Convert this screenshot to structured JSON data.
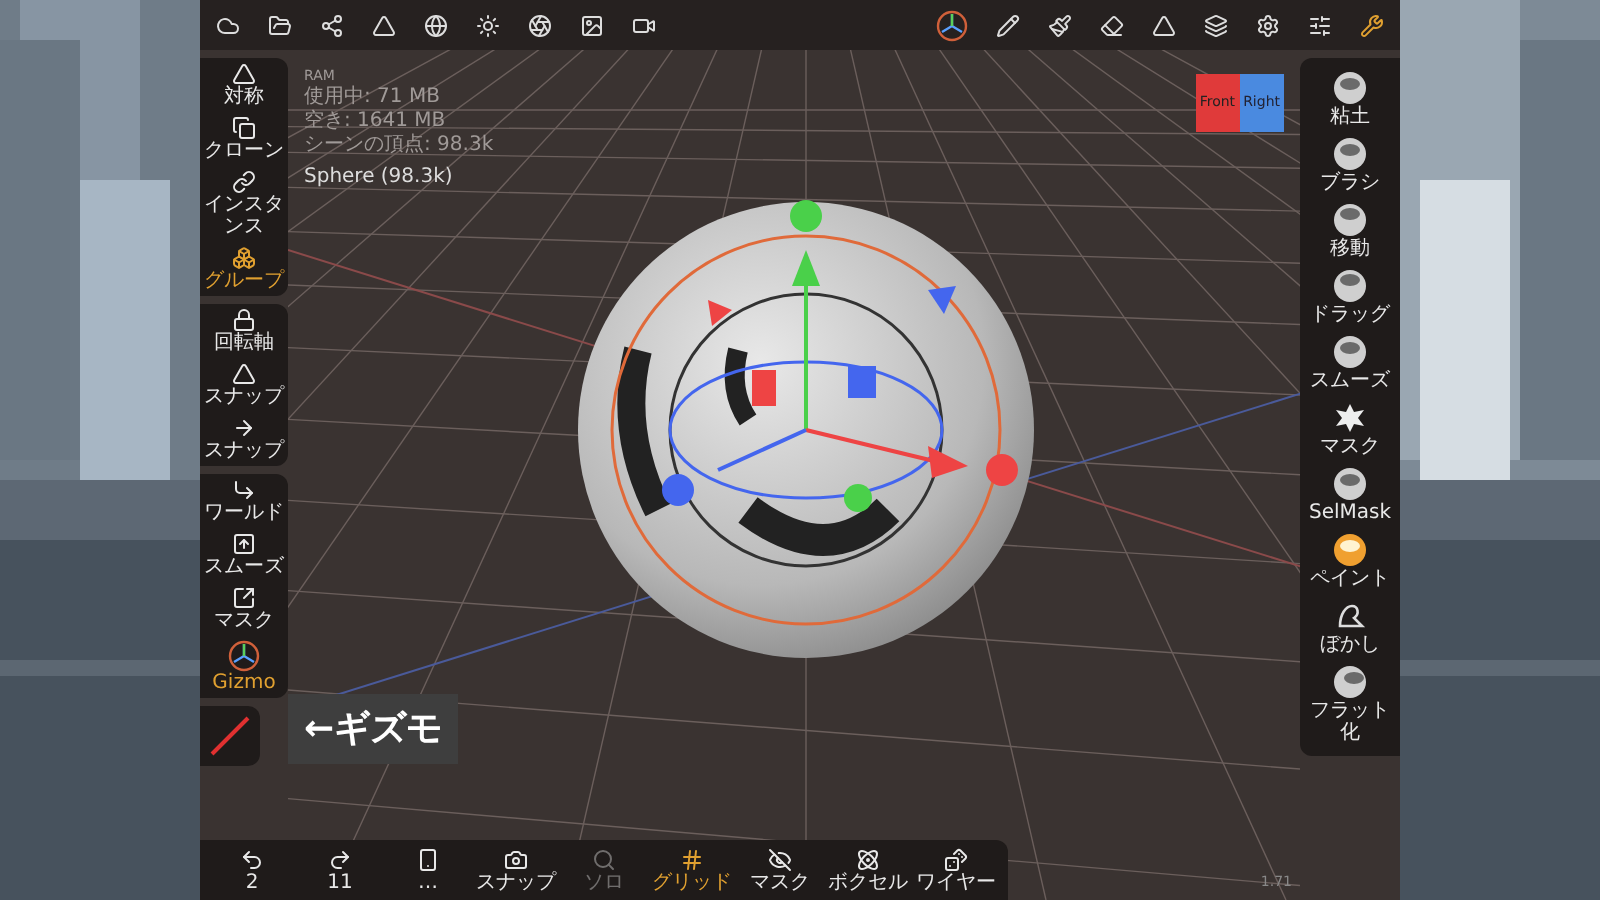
{
  "stats": {
    "title": "RAM",
    "lines": [
      "使用中: 71 MB",
      "空き: 1641 MB",
      "シーンの頂点: 98.3k"
    ],
    "object": "Sphere (98.3k)"
  },
  "left_toolbar": {
    "groups": [
      {
        "items": [
          {
            "label": "対称",
            "active": false
          },
          {
            "label": "クローン",
            "active": false
          },
          {
            "label": "インスタンス",
            "active": false
          },
          {
            "label": "グループ",
            "active": true
          }
        ]
      },
      {
        "items": [
          {
            "label": "回転軸",
            "active": false
          },
          {
            "label": "スナップ",
            "active": false
          },
          {
            "label": "スナップ",
            "active": false
          }
        ]
      },
      {
        "items": [
          {
            "label": "ワールド",
            "active": false
          },
          {
            "label": "スムーズ",
            "active": false
          },
          {
            "label": "マスク",
            "active": false
          },
          {
            "label": "Gizmo",
            "active": true
          }
        ]
      }
    ]
  },
  "right_toolbar": {
    "items": [
      {
        "label": "粘土"
      },
      {
        "label": "ブラシ"
      },
      {
        "label": "移動"
      },
      {
        "label": "ドラッグ"
      },
      {
        "label": "スムーズ"
      },
      {
        "label": "マスク"
      },
      {
        "label": "SelMask"
      },
      {
        "label": "ペイント"
      },
      {
        "label": "ぼかし"
      },
      {
        "label": "フラット化"
      }
    ]
  },
  "bottom_toolbar": {
    "items": [
      {
        "label": "2",
        "active": false,
        "disabled": false
      },
      {
        "label": "11",
        "active": false,
        "disabled": false
      },
      {
        "label": "…",
        "active": false,
        "disabled": false
      },
      {
        "label": "スナップ",
        "active": false,
        "disabled": false
      },
      {
        "label": "ソロ",
        "active": false,
        "disabled": true
      },
      {
        "label": "グリッド",
        "active": true,
        "disabled": false
      },
      {
        "label": "マスク",
        "active": false,
        "disabled": false
      },
      {
        "label": "ボクセル",
        "active": false,
        "disabled": false
      },
      {
        "label": "ワイヤー",
        "active": false,
        "disabled": false
      }
    ]
  },
  "view_cube": {
    "front": "Front",
    "right": "Right"
  },
  "annotation": "←ギズモ",
  "corner_text": "1.71"
}
